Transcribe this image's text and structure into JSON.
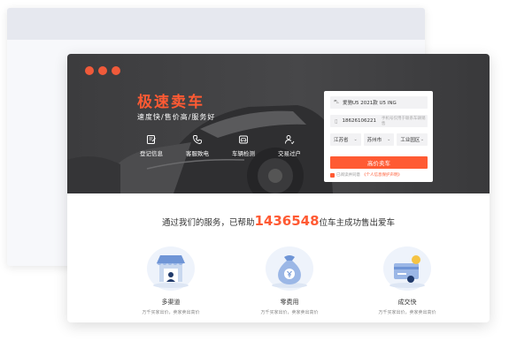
{
  "hero": {
    "title": "极速卖车",
    "subtitle": "速度快/售价高/服务好",
    "features": [
      {
        "label": "登记信息",
        "icon": "register-icon"
      },
      {
        "label": "客服致电",
        "icon": "phone-icon"
      },
      {
        "label": "车辆检测",
        "icon": "car-inspection-icon"
      },
      {
        "label": "交易过户",
        "icon": "transfer-icon"
      }
    ]
  },
  "form": {
    "car_model": "爱驰U5 2021款 U5 ING",
    "phone": "18626106221",
    "phone_placeholder": "手机号仅用于联系车辆销售",
    "province": "江苏省",
    "city": "苏州市",
    "district": "工业园区",
    "submit_label": "高价卖车",
    "agree_text": "已阅读并同意",
    "agree_link": "《个人信息保护声明》"
  },
  "stats": {
    "prefix": "通过我们的服务，已帮助",
    "count": "1436548",
    "suffix": "位车主成功售出爱车"
  },
  "benefits": [
    {
      "title": "多渠道",
      "desc": "万千买家出价，卖家卖出高价",
      "icon": "store-icon"
    },
    {
      "title": "零费用",
      "desc": "万千买家出价，卖家卖出高价",
      "icon": "money-bag-icon"
    },
    {
      "title": "成交快",
      "desc": "万千买家出价，卖家卖出高价",
      "icon": "card-icon"
    }
  ],
  "colors": {
    "accent": "#ff5a33",
    "hero_bg": "#414143"
  }
}
